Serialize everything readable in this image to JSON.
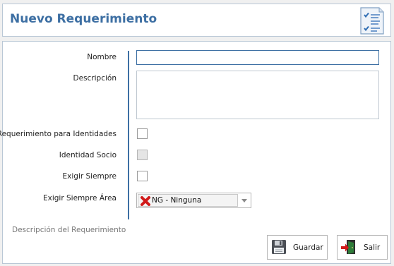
{
  "header": {
    "title": "Nuevo Requerimiento",
    "icon": "checklist-icon",
    "accent_color": "#3d6fa3"
  },
  "form": {
    "nombre_label": "Nombre",
    "nombre_value": "",
    "descripcion_label": "Descripción",
    "descripcion_value": "",
    "req_identidades_label": "Requerimiento para Identidades",
    "req_identidades_checked": false,
    "identidad_socio_label": "Identidad Socio",
    "identidad_socio_checked": false,
    "identidad_socio_enabled": false,
    "exigir_siempre_label": "Exigir Siempre",
    "exigir_siempre_checked": false,
    "exigir_area_label": "Exigir Siempre Área",
    "exigir_area_value": "NG - Ninguna",
    "exigir_area_icon": "red-x-icon"
  },
  "caption": "Descripción del Requerimiento",
  "buttons": {
    "save_label": "Guardar",
    "save_icon": "floppy-disk-icon",
    "exit_label": "Salir",
    "exit_icon": "exit-door-icon"
  }
}
